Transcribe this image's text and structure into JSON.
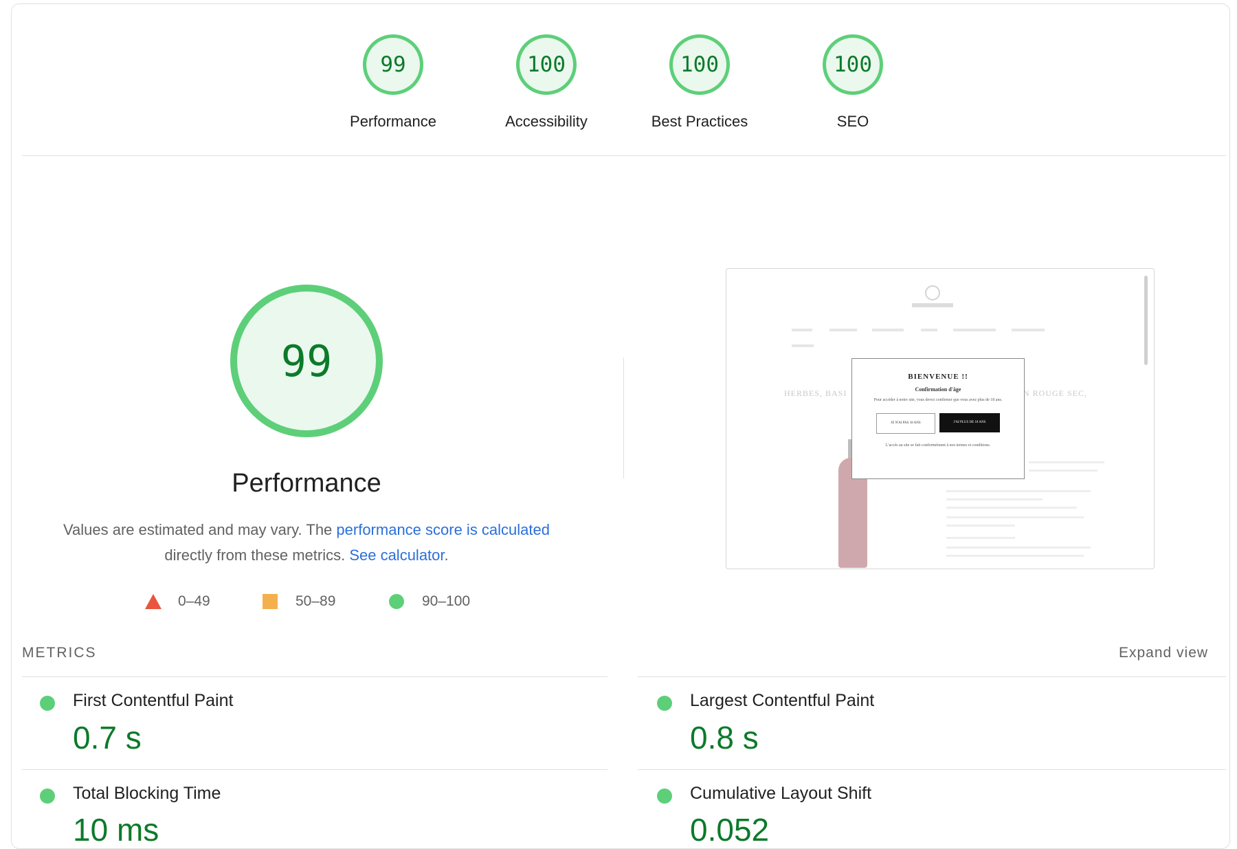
{
  "categories": [
    {
      "score": "99",
      "label": "Performance"
    },
    {
      "score": "100",
      "label": "Accessibility"
    },
    {
      "score": "100",
      "label": "Best Practices"
    },
    {
      "score": "100",
      "label": "SEO"
    }
  ],
  "performance": {
    "score": "99",
    "title": "Performance",
    "desc_part1": "Values are estimated and may vary. The ",
    "desc_link1": "performance score is calculated",
    "desc_part2": " directly from these metrics. ",
    "desc_link2": "See calculator",
    "desc_end": "."
  },
  "legend": {
    "fail": "0–49",
    "average": "50–89",
    "pass": "90–100",
    "colors": {
      "fail": "#e9553d",
      "average": "#f5b04e",
      "pass": "#5dcf79"
    }
  },
  "screenshot": {
    "modal_title": "BIENVENUE !!",
    "modal_subtitle": "Confirmation d'âge",
    "modal_text": "Pour accéder à notre site, vous devez confirmer que vous avez plus de 18 ans.",
    "btn_decline": "JE N'AI PAS 18 ANS",
    "btn_accept": "J'AI PLUS DE 18 ANS",
    "modal_footer": "L'accès au site se fait conformément à nos termes et conditions.",
    "heading_left": "HERBES, BASI",
    "heading_right": "N ROUGE SEC,"
  },
  "metrics": {
    "header": "METRICS",
    "expand": "Expand view",
    "items": [
      {
        "title": "First Contentful Paint",
        "value": "0.7 s"
      },
      {
        "title": "Largest Contentful Paint",
        "value": "0.8 s"
      },
      {
        "title": "Total Blocking Time",
        "value": "10 ms"
      },
      {
        "title": "Cumulative Layout Shift",
        "value": "0.052"
      }
    ]
  }
}
